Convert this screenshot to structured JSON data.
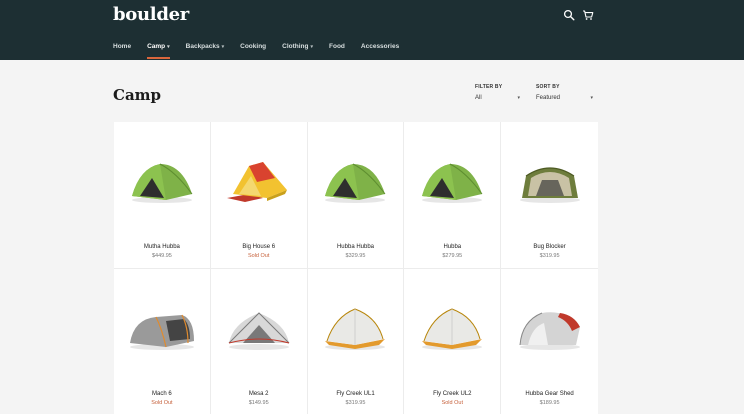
{
  "brand": {
    "logo": "boulder"
  },
  "header_icons": [
    {
      "name": "search-icon"
    },
    {
      "name": "cart-icon"
    }
  ],
  "nav": [
    {
      "label": "Home",
      "dropdown": false,
      "active": false
    },
    {
      "label": "Camp",
      "dropdown": true,
      "active": true
    },
    {
      "label": "Backpacks",
      "dropdown": true,
      "active": false
    },
    {
      "label": "Cooking",
      "dropdown": false,
      "active": false
    },
    {
      "label": "Clothing",
      "dropdown": true,
      "active": false
    },
    {
      "label": "Food",
      "dropdown": false,
      "active": false
    },
    {
      "label": "Accessories",
      "dropdown": false,
      "active": false
    }
  ],
  "page": {
    "title": "Camp"
  },
  "filters": {
    "filter_by": {
      "label": "FILTER BY",
      "value": "All"
    },
    "sort_by": {
      "label": "SORT BY",
      "value": "Featured"
    }
  },
  "colors": {
    "header_bg": "#1d2f33",
    "accent": "#d9663c",
    "sold_out": "#c6603a"
  },
  "products": [
    {
      "name": "Mutha Hubba",
      "price": "$449.95",
      "sold_out": false,
      "icon": "green-dome-tent"
    },
    {
      "name": "Big House 6",
      "price": "Sold Out",
      "sold_out": true,
      "icon": "yellow-cabin-tent"
    },
    {
      "name": "Hubba Hubba",
      "price": "$329.95",
      "sold_out": false,
      "icon": "green-dome-tent"
    },
    {
      "name": "Hubba",
      "price": "$279.95",
      "sold_out": false,
      "icon": "green-dome-tent"
    },
    {
      "name": "Bug Blocker",
      "price": "$319.95",
      "sold_out": false,
      "icon": "khaki-screen-tent"
    },
    {
      "name": "Mach 6",
      "price": "Sold Out",
      "sold_out": true,
      "icon": "gray-tunnel-tent"
    },
    {
      "name": "Mesa 2",
      "price": "$149.95",
      "sold_out": false,
      "icon": "gray-mesh-tent"
    },
    {
      "name": "Fly Creek UL1",
      "price": "$319.95",
      "sold_out": false,
      "icon": "orange-mesh-tent"
    },
    {
      "name": "Fly Creek UL2",
      "price": "Sold Out",
      "sold_out": true,
      "icon": "orange-mesh-tent"
    },
    {
      "name": "Hubba Gear Shed",
      "price": "$189.95",
      "sold_out": false,
      "icon": "gray-red-shed-tent"
    }
  ]
}
